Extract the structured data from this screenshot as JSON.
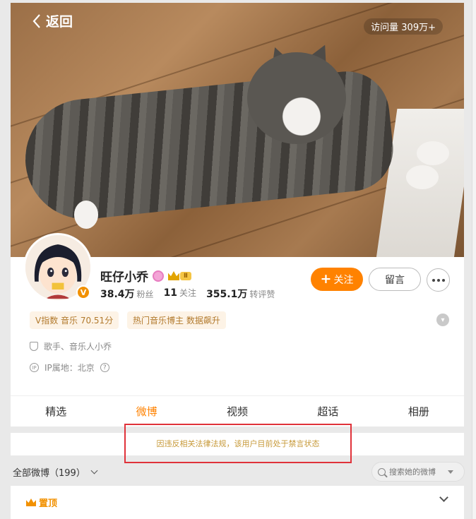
{
  "header": {
    "back_label": "返回",
    "visits": "访问量 309万+"
  },
  "profile": {
    "name": "旺仔小乔",
    "level_badge": "Ⅱ",
    "verified_mark": "V",
    "stats": [
      {
        "value": "38.4万",
        "label": "粉丝"
      },
      {
        "value": "11",
        "label": "关注"
      },
      {
        "value": "355.1万",
        "label": "转评赞"
      }
    ],
    "follow_label": "关注",
    "message_label": "留言"
  },
  "tags": [
    {
      "text": "V指数 音乐 70.51分"
    },
    {
      "text": "热门音乐博主 数据飙升"
    }
  ],
  "info": {
    "occupation": "歌手、音乐人小乔",
    "ip_location": "IP属地：北京",
    "help_mark": "?"
  },
  "tabs": [
    {
      "label": "精选",
      "active": false
    },
    {
      "label": "微博",
      "active": true
    },
    {
      "label": "视频",
      "active": false
    },
    {
      "label": "超话",
      "active": false
    },
    {
      "label": "相册",
      "active": false
    }
  ],
  "notice": "因违反相关法律法规，该用户目前处于禁言状态",
  "feed": {
    "title": "全部微博（199）",
    "search_placeholder": "搜索她的微博",
    "pinned_label": "置顶"
  },
  "colors": {
    "accent": "#ff8200",
    "notice_border": "#e0323a",
    "tag_bg": "#fdf3e6",
    "tag_text": "#b27a2d"
  },
  "icons": [
    "back-icon",
    "pink-badge-icon",
    "crown-icon",
    "more-icon",
    "shield-icon",
    "ip-icon",
    "help-icon",
    "search-icon",
    "dropdown-icon",
    "pin-icon",
    "chevron-down-icon"
  ]
}
